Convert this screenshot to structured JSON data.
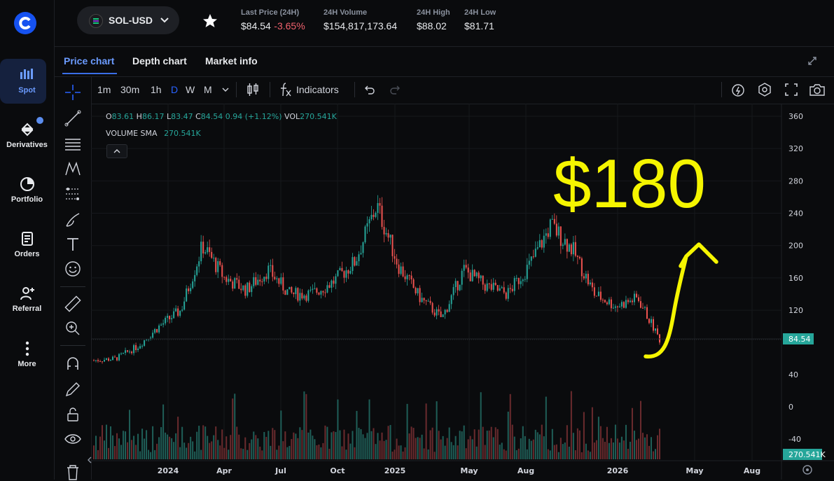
{
  "sidebar": {
    "items": [
      {
        "label": "Spot",
        "icon": "bar-chart-icon"
      },
      {
        "label": "Derivatives",
        "icon": "derivatives-icon"
      },
      {
        "label": "Portfolio",
        "icon": "pie-chart-icon"
      },
      {
        "label": "Orders",
        "icon": "document-icon"
      },
      {
        "label": "Referral",
        "icon": "add-user-icon"
      },
      {
        "label": "More",
        "icon": "more-vertical-icon"
      }
    ]
  },
  "header": {
    "pair": "SOL-USD",
    "stats": [
      {
        "label": "Last Price (24H)",
        "value": "$84.54",
        "change": "-3.65%"
      },
      {
        "label": "24H Volume",
        "value": "$154,817,173.64"
      },
      {
        "label": "24H High",
        "value": "$88.02"
      },
      {
        "label": "24H Low",
        "value": "$81.71"
      }
    ]
  },
  "tabs": [
    "Price chart",
    "Depth chart",
    "Market info"
  ],
  "toolbar": {
    "timeframes": [
      "1m",
      "30m",
      "1h",
      "D",
      "W",
      "M"
    ],
    "active_timeframe": "D",
    "indicators_label": "Indicators"
  },
  "legend": {
    "o_label": "O",
    "o_val": "83.61",
    "h_label": "H",
    "h_val": "86.17",
    "l_label": "L",
    "l_val": "83.47",
    "c_label": "C",
    "c_val": "84.54",
    "change": "0.94 (+1.12%)",
    "vol_label": "VOL",
    "vol_val": "270.541K",
    "sma_label": "VOLUME SMA",
    "sma_val": "270.541K"
  },
  "annotation": {
    "text": "$180",
    "color": "#f5f500"
  },
  "colors": {
    "up": "#26a69a",
    "down": "#ef5350",
    "accent": "#2962ff",
    "price_tag": "#26a69a"
  },
  "chart_data": {
    "type": "candlestick",
    "price_axis": {
      "ticks": [
        "360",
        "320",
        "280",
        "240",
        "200",
        "160",
        "120"
      ],
      "range": [
        40,
        370
      ]
    },
    "volume_axis": {
      "ticks": [
        "40",
        "0",
        "-40"
      ]
    },
    "x_ticks": [
      "2024",
      "Apr",
      "Jul",
      "Oct",
      "2025",
      "May",
      "Aug",
      "2026",
      "May",
      "Aug"
    ],
    "last_price_label": "84.54",
    "volume_label": "270.541K",
    "approx_close_path": {
      "x": [
        "2023-11",
        "2023-12",
        "2024-01",
        "2024-02",
        "2024-03",
        "2024-04",
        "2024-05",
        "2024-06",
        "2024-07",
        "2024-08",
        "2024-09",
        "2024-10",
        "2024-11",
        "2025-01",
        "2025-02",
        "2025-03",
        "2025-04",
        "2025-05",
        "2025-06",
        "2025-07",
        "2025-08",
        "2025-09",
        "2025-10",
        "2025-11",
        "2025-12",
        "2026-01",
        "2026-02"
      ],
      "y": [
        58,
        60,
        75,
        100,
        120,
        200,
        160,
        145,
        170,
        140,
        140,
        155,
        180,
        250,
        175,
        135,
        110,
        170,
        150,
        140,
        175,
        225,
        195,
        140,
        125,
        135,
        84
      ]
    }
  }
}
